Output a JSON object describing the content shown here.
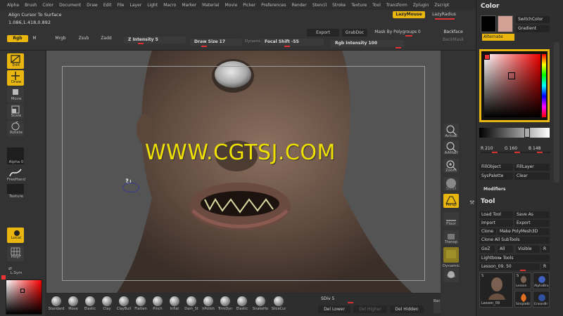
{
  "menu": [
    "Alpha",
    "Brush",
    "Color",
    "Document",
    "Draw",
    "Edit",
    "File",
    "Layer",
    "Light",
    "Macro",
    "Marker",
    "Material",
    "Movie",
    "Picker",
    "Preferences",
    "Render",
    "Stencil",
    "Stroke",
    "Texture",
    "Tool",
    "Transform",
    "Zplugin",
    "Zscript"
  ],
  "status": {
    "line1": "Align Cursor To Surface",
    "line2": "1.086,1.418,0.892"
  },
  "top": {
    "lazymouse": "LazyMouse",
    "lazyradius": "LazyRadius",
    "rgb": "Rgb",
    "m": "M",
    "mrgb": "Mrgb",
    "zsub": "Zsub",
    "zadd": "Zadd",
    "z_intensity": "Z Intensity 5",
    "draw_size": "Draw Size 17",
    "dynamic": "Dynamic",
    "focal_shift": "Focal Shift -55",
    "rgb_intensity": "Rgb Intensity 100",
    "export": "Export",
    "grabdoc": "GrabDoc",
    "mask_by_polygroups": "Mask By Polygroups 0",
    "backface": "Backface",
    "backmask": "BackMask"
  },
  "left": {
    "edit": "Edit",
    "draw": "Draw",
    "move": "Move",
    "scale": "Scale",
    "rotate": "Rotate",
    "alpha": "Alpha 0",
    "freehand": "FreeHand",
    "texture": "Texture",
    "local": "Local",
    "polyf": "PolyF",
    "lsym": "L.Sym"
  },
  "right": {
    "actual": "Actual",
    "aahalf": "AAHalf",
    "zoom": "Zoom",
    "scroll": "Scroll",
    "persp": "Persp",
    "floor": "Floor",
    "transp": "Transp",
    "dynamic": "Dynamic",
    "solo": "Solo"
  },
  "watermark": "WWW.CGTSJ.COM",
  "brushes": [
    "Standard",
    "Move",
    "Elastic",
    "Clay",
    "ClayBuil",
    "Flatten",
    "Pinch",
    "Inflat",
    "Dam_St",
    "hPolish",
    "TrimDyn",
    "Elastic",
    "SnakeHo",
    "SliceCur"
  ],
  "bottom": {
    "sdiv": "SDiv 5",
    "del_lower": "Del Lower",
    "del_higher": "Del Higher",
    "del_hidden": "Del Hidden",
    "bac": "Bac"
  },
  "palette": {
    "color_title": "Color",
    "switchcolor": "SwitchColor",
    "gradient": "Gradient",
    "alternate": "Alternate",
    "r": "R 210",
    "g": "G 160",
    "b": "B 148",
    "fillobject": "FillObject",
    "filllayer": "FillLayer",
    "syspalette": "SysPalette",
    "clear": "Clear",
    "modifiers": "Modifiers",
    "tool_title": "Tool",
    "load_tool": "Load Tool",
    "save_as": "Save As",
    "import": "Import",
    "export": "Export",
    "clone": "Clone",
    "make_polymesh": "Make PolyMesh3D",
    "clone_all": "Clone All SubTools",
    "goz": "GoZ",
    "all": "All",
    "visible": "Visible",
    "r_btn": "R",
    "lightbox_tools": "Lightbox▸ Tools",
    "lesson": "Lesson_09. 50",
    "r_btn2": "R",
    "thumb1": "Lesson_09",
    "thumb2": "Lesson",
    "thumb3": "AlphaBru",
    "thumb4": "SimpleBr",
    "thumb5": "EraserBr",
    "s1": "S",
    "s2": "S"
  },
  "colors": {
    "accent": "#e8b60e",
    "primary_swatch": "#d2a094",
    "secondary_swatch": "#000000"
  }
}
